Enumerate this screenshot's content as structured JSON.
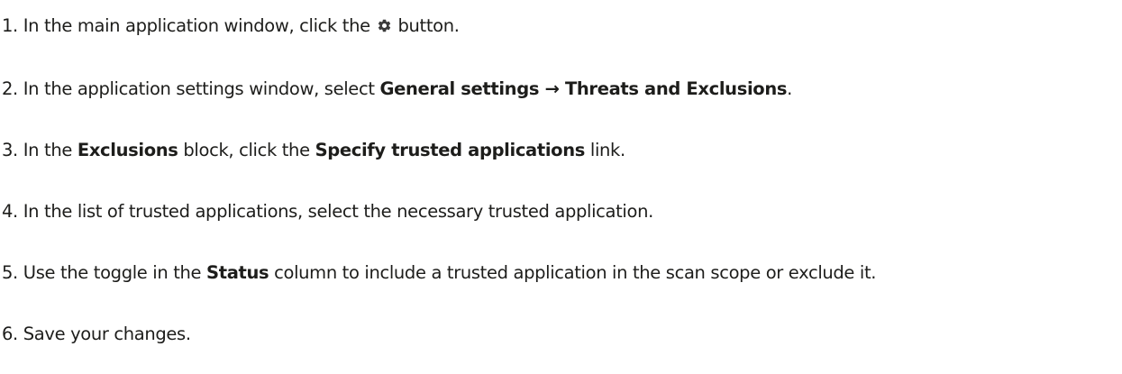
{
  "instructions": {
    "step1": {
      "num": "1.",
      "before": "In the main application window, click the",
      "icon": "gear-icon",
      "after": "button."
    },
    "step2": {
      "num": "2.",
      "before": "In the application settings window, select",
      "bold": "General settings → Threats and Exclusions",
      "after": "."
    },
    "step3": {
      "num": "3.",
      "before": "In the",
      "bold1": "Exclusions",
      "mid": "block, click the",
      "bold2": "Specify trusted applications",
      "after": "link."
    },
    "step4": {
      "num": "4.",
      "text": "In the list of trusted applications, select the necessary trusted application."
    },
    "step5": {
      "num": "5.",
      "before": "Use the toggle in the",
      "bold": "Status",
      "after": "column to include a trusted application in the scan scope or exclude it."
    },
    "step6": {
      "num": "6.",
      "text": "Save your changes."
    }
  }
}
